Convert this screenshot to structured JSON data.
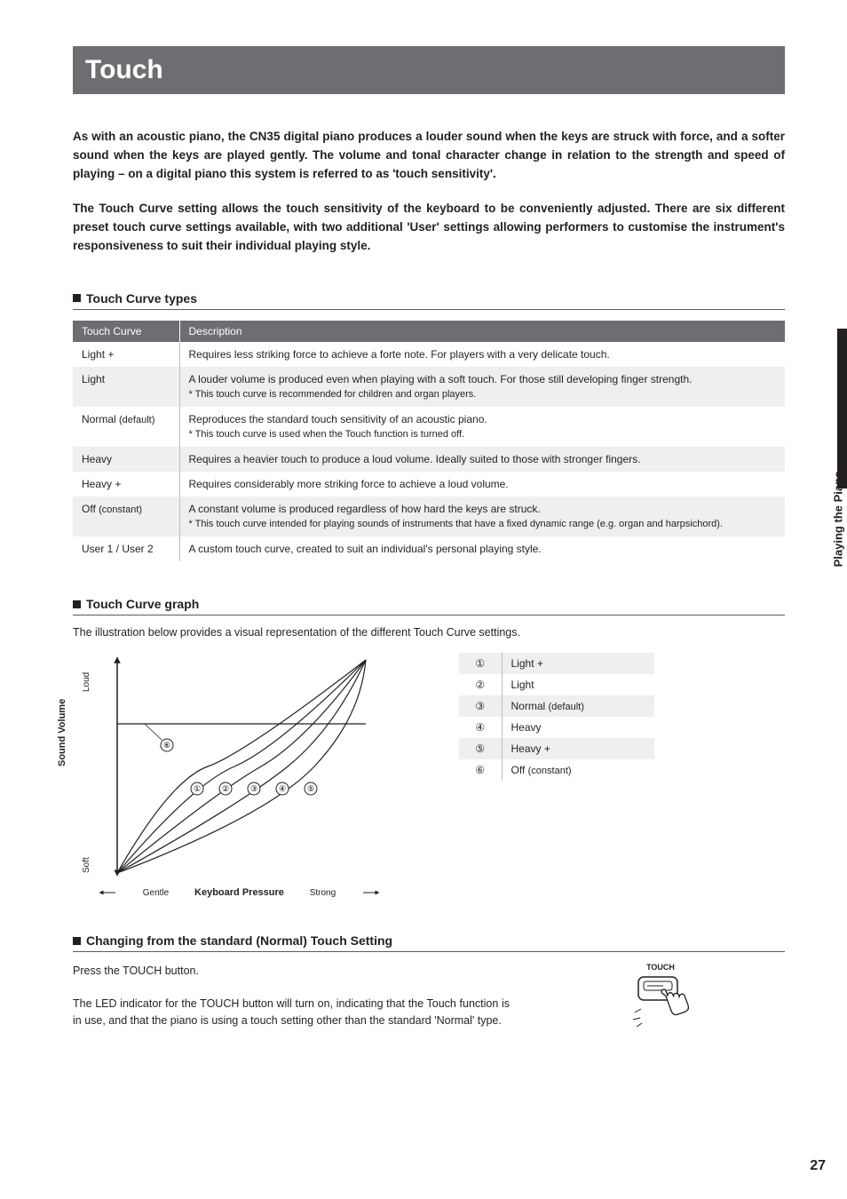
{
  "title": "Touch",
  "intro1": "As with an acoustic piano, the CN35 digital piano produces a louder sound when the keys are struck with force, and a softer sound when the keys are played gently.  The volume and tonal character change in relation to the strength and speed of playing – on a digital piano this system is referred to as 'touch sensitivity'.",
  "intro2": "The Touch Curve setting allows the touch sensitivity of the keyboard to be conveniently adjusted.  There are six different preset touch curve settings available, with two additional 'User' settings allowing performers to customise the instrument's responsiveness to suit their individual playing style.",
  "sections": {
    "types": "Touch Curve types",
    "graph": "Touch Curve graph",
    "change": "Changing from the standard (Normal) Touch Setting"
  },
  "table": {
    "h1": "Touch Curve",
    "h2": "Description",
    "rows": [
      {
        "name": "Light +",
        "desc": "Requires less striking force to achieve a forte note. For players with a very delicate touch."
      },
      {
        "name": "Light",
        "desc": "A louder volume is produced even when playing with a soft touch. For those still developing finger strength.",
        "note": "* This touch curve is recommended for children and organ players."
      },
      {
        "name_a": "Normal ",
        "name_b": "(default)",
        "desc": "Reproduces the standard touch sensitivity of an acoustic piano.",
        "note": "* This touch curve is used when the Touch function is turned off."
      },
      {
        "name": "Heavy",
        "desc": "Requires a heavier touch to produce a loud volume. Ideally suited to those with stronger fingers."
      },
      {
        "name": "Heavy +",
        "desc": "Requires considerably more striking force to achieve a loud volume."
      },
      {
        "name_a": "Off ",
        "name_b": "(constant)",
        "desc": "A constant volume is produced regardless of how hard the keys are struck.",
        "note": "* This touch curve intended for playing sounds of instruments that have a fixed dynamic range (e.g. organ and harpsichord)."
      },
      {
        "name": "User 1 / User 2",
        "desc": "A custom touch curve, created to suit an individual's personal playing style."
      }
    ]
  },
  "graph_desc": "The illustration below provides a visual representation of the different Touch Curve settings.",
  "axes": {
    "y_title": "Sound Volume",
    "y_soft": "Soft",
    "y_loud": "Loud",
    "x_title": "Keyboard Pressure",
    "x_gentle": "Gentle",
    "x_strong": "Strong"
  },
  "legend": [
    {
      "n": "①",
      "t": "Light +"
    },
    {
      "n": "②",
      "t": "Light"
    },
    {
      "n_a": "③",
      "t_a": "Normal ",
      "t_b": "(default)"
    },
    {
      "n": "④",
      "t": "Heavy"
    },
    {
      "n": "⑤",
      "t": "Heavy +"
    },
    {
      "n_a": "⑥",
      "t_a": "Off ",
      "t_b": "(constant)"
    }
  ],
  "curve_labels": [
    "①",
    "②",
    "③",
    "④",
    "⑤",
    "⑥"
  ],
  "change": {
    "p1": "Press the TOUCH button.",
    "p2": "The LED indicator for the TOUCH button will turn on, indicating that the Touch function is in use, and that the piano is using a touch setting other than the standard 'Normal' type.",
    "btn": "TOUCH"
  },
  "side": "Playing the Piano",
  "pagenum": "27",
  "chart_data": {
    "type": "line",
    "title": "Touch Curve graph",
    "xlabel": "Keyboard Pressure",
    "ylabel": "Sound Volume",
    "xlim": [
      0,
      100
    ],
    "ylim": [
      0,
      100
    ],
    "x_ticks": [
      "Gentle",
      "Strong"
    ],
    "y_ticks": [
      "Soft",
      "Loud"
    ],
    "series": [
      {
        "name": "Light +",
        "x": [
          0,
          36,
          100
        ],
        "y": [
          0,
          50,
          100
        ]
      },
      {
        "name": "Light",
        "x": [
          0,
          47,
          100
        ],
        "y": [
          0,
          50,
          100
        ]
      },
      {
        "name": "Normal (default)",
        "x": [
          0,
          58,
          100
        ],
        "y": [
          0,
          50,
          100
        ]
      },
      {
        "name": "Heavy",
        "x": [
          0,
          69,
          100
        ],
        "y": [
          0,
          50,
          100
        ]
      },
      {
        "name": "Heavy +",
        "x": [
          0,
          80,
          100
        ],
        "y": [
          0,
          50,
          100
        ]
      },
      {
        "name": "Off (constant)",
        "x": [
          0,
          100
        ],
        "y": [
          70,
          70
        ]
      }
    ],
    "legend_position": "right"
  }
}
